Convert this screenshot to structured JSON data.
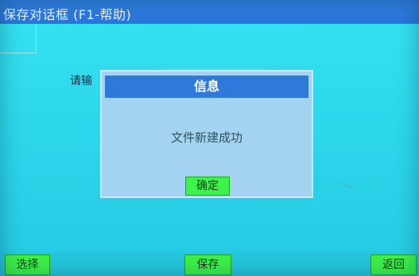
{
  "window": {
    "title": "保存对话框 (F1-帮助)"
  },
  "form": {
    "input_label": "请输"
  },
  "dialog": {
    "title": "信息",
    "message": "文件新建成功",
    "ok_label": "确定"
  },
  "bottom_bar": {
    "select_label": "选择",
    "save_label": "保存",
    "back_label": "返回"
  }
}
